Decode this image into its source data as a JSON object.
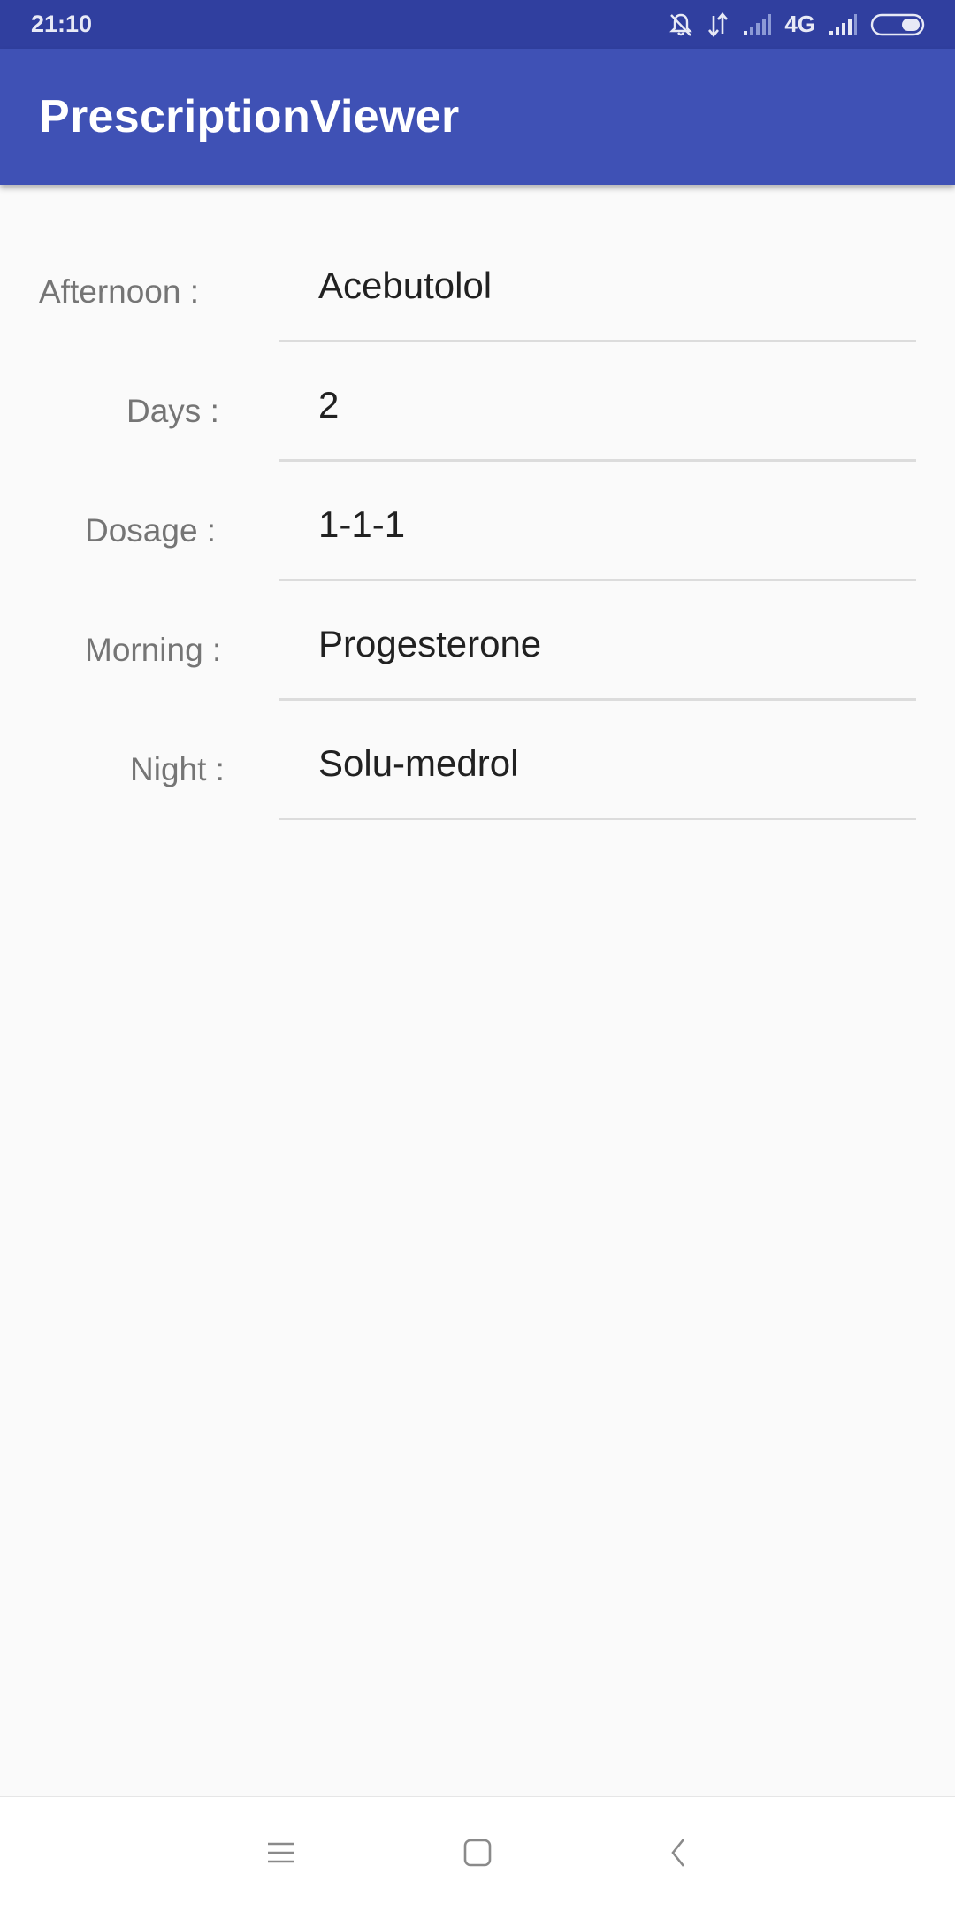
{
  "status_bar": {
    "time": "21:10",
    "network": "4G",
    "icons": [
      "bell-off-icon",
      "data-arrows-icon",
      "signal-icon",
      "signal-icon",
      "battery-icon"
    ]
  },
  "app_bar": {
    "title": "PrescriptionViewer",
    "color": "#3f51b5"
  },
  "fields": [
    {
      "label": "Afternoon :",
      "value": "Acebutolol"
    },
    {
      "label": "Days :",
      "value": "2"
    },
    {
      "label": "Dosage :",
      "value": "1-1-1"
    },
    {
      "label": "Morning :",
      "value": "Progesterone"
    },
    {
      "label": "Night :",
      "value": "Solu-medrol"
    }
  ],
  "nav_bar": {
    "icons": [
      "menu-icon",
      "home-icon",
      "back-icon"
    ]
  }
}
